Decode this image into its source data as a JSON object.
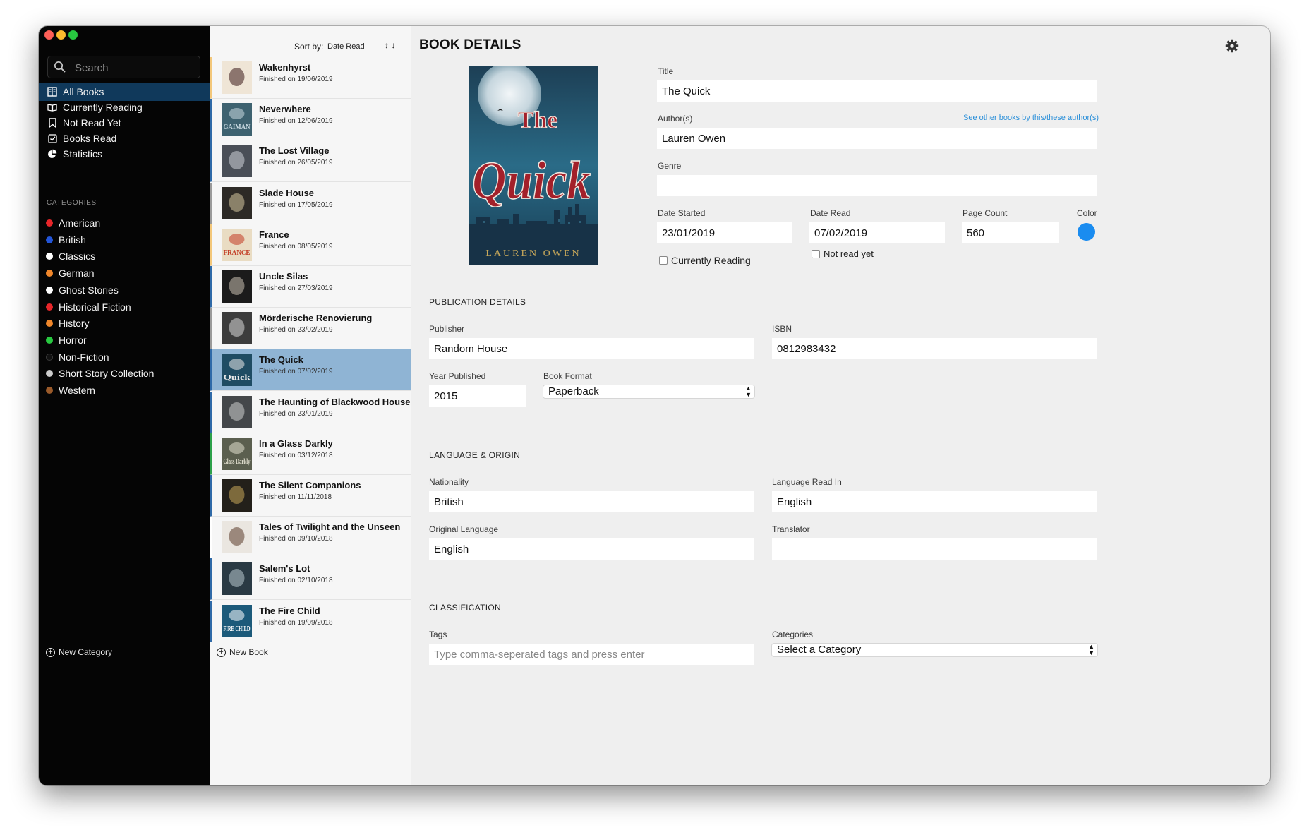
{
  "window": {
    "traffic_lights": [
      "#fe5f57",
      "#febc2e",
      "#28c840"
    ]
  },
  "sidebar": {
    "search": {
      "placeholder": "Search",
      "icon": "search-icon"
    },
    "nav": [
      {
        "label": "All Books",
        "icon": "books-icon",
        "active": true
      },
      {
        "label": "Currently Reading",
        "icon": "open-book-icon",
        "active": false
      },
      {
        "label": "Not Read Yet",
        "icon": "bookmark-icon",
        "active": false
      },
      {
        "label": "Books Read",
        "icon": "checkbox-icon",
        "active": false
      },
      {
        "label": "Statistics",
        "icon": "pie-chart-icon",
        "active": false
      }
    ],
    "categories_heading": "CATEGORIES",
    "categories": [
      {
        "name": "American",
        "color": "#e8262a"
      },
      {
        "name": "British",
        "color": "#2355d8"
      },
      {
        "name": "Classics",
        "color": "#ffffff"
      },
      {
        "name": "German",
        "color": "#f0872b"
      },
      {
        "name": "Ghost Stories",
        "color": "#ffffff"
      },
      {
        "name": "Historical Fiction",
        "color": "#e8262a"
      },
      {
        "name": "History",
        "color": "#f0872b"
      },
      {
        "name": "Horror",
        "color": "#28c840"
      },
      {
        "name": "Non-Fiction",
        "color": "#111111"
      },
      {
        "name": "Short Story Collection",
        "color": "#cccccc"
      },
      {
        "name": "Western",
        "color": "#9a5a2a"
      }
    ],
    "new_category": "New Category"
  },
  "book_list": {
    "sort_label": "Sort by:",
    "sort_value": "Date Read",
    "sort_arrows": "↕ ↓",
    "books": [
      {
        "title": "Wakenhyrst",
        "finished": "Finished on 19/06/2019",
        "accent": "#f3c77a",
        "cover_bg": "#efe5d6",
        "cover_fg": "#3a1a1a"
      },
      {
        "title": "Neverwhere",
        "finished": "Finished on 12/06/2019",
        "accent": "#2f6aa8",
        "cover_bg": "#3e6270",
        "cover_fg": "#c8d8e0"
      },
      {
        "title": "The Lost Village",
        "finished": "Finished on 26/05/2019",
        "accent": "#2f6aa8",
        "cover_bg": "#4a4f57",
        "cover_fg": "#cfd3d8"
      },
      {
        "title": "Slade House",
        "finished": "Finished on 17/05/2019",
        "accent": "#9a9a9a",
        "cover_bg": "#2d2a26",
        "cover_fg": "#d7c8a0"
      },
      {
        "title": "France",
        "finished": "Finished on 08/05/2019",
        "accent": "#f3c77a",
        "cover_bg": "#e9dcc3",
        "cover_fg": "#c23a22"
      },
      {
        "title": "Uncle Silas",
        "finished": "Finished on 27/03/2019",
        "accent": "#2f6aa8",
        "cover_bg": "#1b1b1b",
        "cover_fg": "#c9bfb0"
      },
      {
        "title": "Mörderische Renovierung",
        "finished": "Finished on 23/02/2019",
        "accent": "#9a9a9a",
        "cover_bg": "#3c3c3c",
        "cover_fg": "#d9d9d9"
      },
      {
        "title": "The Quick",
        "finished": "Finished on 07/02/2019",
        "accent": "#2f6aa8",
        "cover_bg": "#1f4c63",
        "cover_fg": "#e9e9e9"
      },
      {
        "title": "The Haunting of Blackwood House",
        "finished": "Finished on 23/01/2019",
        "accent": "#2f6aa8",
        "cover_bg": "#44474a",
        "cover_fg": "#d0d0d0"
      },
      {
        "title": "In a Glass Darkly",
        "finished": "Finished on 03/12/2018",
        "accent": "#2da14a",
        "cover_bg": "#5b5f4f",
        "cover_fg": "#e2e0d0"
      },
      {
        "title": "The Silent Companions",
        "finished": "Finished on 11/11/2018",
        "accent": "#2f6aa8",
        "cover_bg": "#23201a",
        "cover_fg": "#c9a85a"
      },
      {
        "title": "Tales of Twilight and the Unseen",
        "finished": "Finished on 09/10/2018",
        "accent": "#ffffff",
        "cover_bg": "#eae6e0",
        "cover_fg": "#5a3a2a"
      },
      {
        "title": "Salem's Lot",
        "finished": "Finished on 02/10/2018",
        "accent": "#2f6aa8",
        "cover_bg": "#2a3a44",
        "cover_fg": "#b8c8d0"
      },
      {
        "title": "The Fire Child",
        "finished": "Finished on 19/09/2018",
        "accent": "#2f6aa8",
        "cover_bg": "#1c5a7a",
        "cover_fg": "#ffffff"
      }
    ],
    "cover_words": {
      "Neverwhere": "GAIMAN",
      "France": "FRANCE",
      "In a Glass Darkly": "Glass Darkly",
      "The Fire Child": "FIRE CHILD",
      "The Quick": "Quick"
    },
    "new_book": "New Book"
  },
  "details": {
    "heading": "BOOK DETAILS",
    "cover": {
      "title_word_1": "The",
      "title_word_2": "Quick",
      "author_text": "LAUREN OWEN"
    },
    "title_label": "Title",
    "title_value": "The Quick",
    "authors_label": "Author(s)",
    "authors_value": "Lauren Owen",
    "authors_link": "See other books by this/these author(s)",
    "genre_label": "Genre",
    "genre_value": "",
    "date_started_label": "Date Started",
    "date_started_value": "23/01/2019",
    "date_read_label": "Date Read",
    "date_read_value": "07/02/2019",
    "page_count_label": "Page Count",
    "page_count_value": "560",
    "color_label": "Color",
    "color_value": "#1a8cf0",
    "currently_reading_label": "Currently Reading",
    "not_read_yet_label": "Not read yet",
    "publication_heading": "PUBLICATION DETAILS",
    "publisher_label": "Publisher",
    "publisher_value": "Random House",
    "isbn_label": "ISBN",
    "isbn_value": "0812983432",
    "year_label": "Year Published",
    "year_value": "2015",
    "format_label": "Book Format",
    "format_value": "Paperback",
    "language_heading": "LANGUAGE & ORIGIN",
    "nationality_label": "Nationality",
    "nationality_value": "British",
    "language_read_label": "Language Read In",
    "language_read_value": "English",
    "original_language_label": "Original Language",
    "original_language_value": "English",
    "translator_label": "Translator",
    "translator_value": "",
    "classification_heading": "CLASSIFICATION",
    "tags_label": "Tags",
    "tags_placeholder": "Type comma-seperated tags and press enter",
    "categories_label": "Categories",
    "categories_value": "Select a Category"
  }
}
